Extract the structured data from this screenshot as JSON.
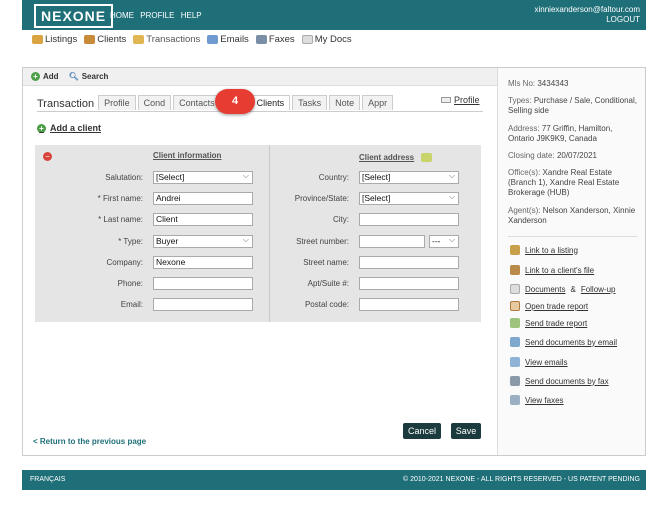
{
  "brand": {
    "logo": "NEXONE",
    "accent": "#1f6f78"
  },
  "topnav": [
    "HOME",
    "PROFILE",
    "HELP"
  ],
  "user": {
    "email": "xinniexanderson@faltour.com",
    "logout": "LOGOUT"
  },
  "secnav": [
    {
      "label": "Listings",
      "icon": "house-icon"
    },
    {
      "label": "Clients",
      "icon": "people-icon"
    },
    {
      "label": "Transactions",
      "icon": "folder-icon"
    },
    {
      "label": "Emails",
      "icon": "envelope-icon"
    },
    {
      "label": "Faxes",
      "icon": "fax-icon"
    },
    {
      "label": "My Docs",
      "icon": "document-icon"
    }
  ],
  "toolbar": {
    "add": "Add",
    "search": "Search"
  },
  "tabs": {
    "title": "Transaction",
    "items": [
      "Profile",
      "Cond",
      "Contacts",
      "",
      "Clients",
      "Tasks",
      "Note",
      "Appr"
    ],
    "active": "Clients",
    "profile_link": "Profile",
    "step_badge": "4"
  },
  "add_client": "Add a client",
  "client_info": {
    "heading": "Client information",
    "salutation": {
      "label": "Salutation:",
      "value": "[Select]"
    },
    "first_name": {
      "label": "* First name:",
      "value": "Andrei"
    },
    "last_name": {
      "label": "* Last name:",
      "value": "Client"
    },
    "type": {
      "label": "* Type:",
      "value": "Buyer"
    },
    "company": {
      "label": "Company:",
      "value": "Nexone"
    },
    "phone": {
      "label": "Phone:",
      "value": ""
    },
    "email": {
      "label": "Email:",
      "value": ""
    }
  },
  "client_address": {
    "heading": "Client address",
    "country": {
      "label": "Country:",
      "value": "[Select]"
    },
    "province": {
      "label": "Province/State:",
      "value": "[Select]"
    },
    "city": {
      "label": "City:",
      "value": ""
    },
    "street_number": {
      "label": "Street number:",
      "value": "",
      "suffix": "---"
    },
    "street_name": {
      "label": "Street name:",
      "value": ""
    },
    "apt": {
      "label": "Apt/Suite #:",
      "value": ""
    },
    "postal": {
      "label": "Postal code:",
      "value": ""
    }
  },
  "buttons": {
    "cancel": "Cancel",
    "save": "Save"
  },
  "prev_link": "< Return to the previous page",
  "sidebar": {
    "mls": {
      "label": "Mls No:",
      "value": "3434343"
    },
    "types": {
      "label": "Types:",
      "value": "Purchase / Sale, Conditional, Selling side"
    },
    "address": {
      "label": "Address:",
      "value": "77 Griffin, Hamilton, Ontario J9K9K9, Canada"
    },
    "closing": {
      "label": "Closing date:",
      "value": "20/07/2021"
    },
    "offices": {
      "label": "Office(s):",
      "value": "Xandre Real Estate (Branch 1), Xandre Real Estate Brokerage (HUB)"
    },
    "agents": {
      "label": "Agent(s):",
      "value": "Nelson Xanderson, Xinnie Xanderson"
    },
    "links": [
      {
        "label": "Link to a listing",
        "icon": "house-link-icon"
      },
      {
        "label": "Link to a client's file",
        "icon": "client-file-icon"
      },
      {
        "label": "Documents",
        "label2": "Follow-up",
        "icon": "documents-icon"
      },
      {
        "label": "Open trade report",
        "icon": "open-report-icon"
      },
      {
        "label": "Send trade report",
        "icon": "send-report-icon"
      },
      {
        "label": "Send documents by email",
        "icon": "email-docs-icon"
      },
      {
        "label": "View emails",
        "icon": "view-emails-icon"
      },
      {
        "label": "Send documents by fax",
        "icon": "fax-docs-icon"
      },
      {
        "label": "View faxes",
        "icon": "view-faxes-icon"
      }
    ]
  },
  "footer": {
    "lang": "FRANÇAIS",
    "copyright": "© 2010-2021 NEXONE - ALL RIGHTS RESERVED - US PATENT PENDING"
  }
}
